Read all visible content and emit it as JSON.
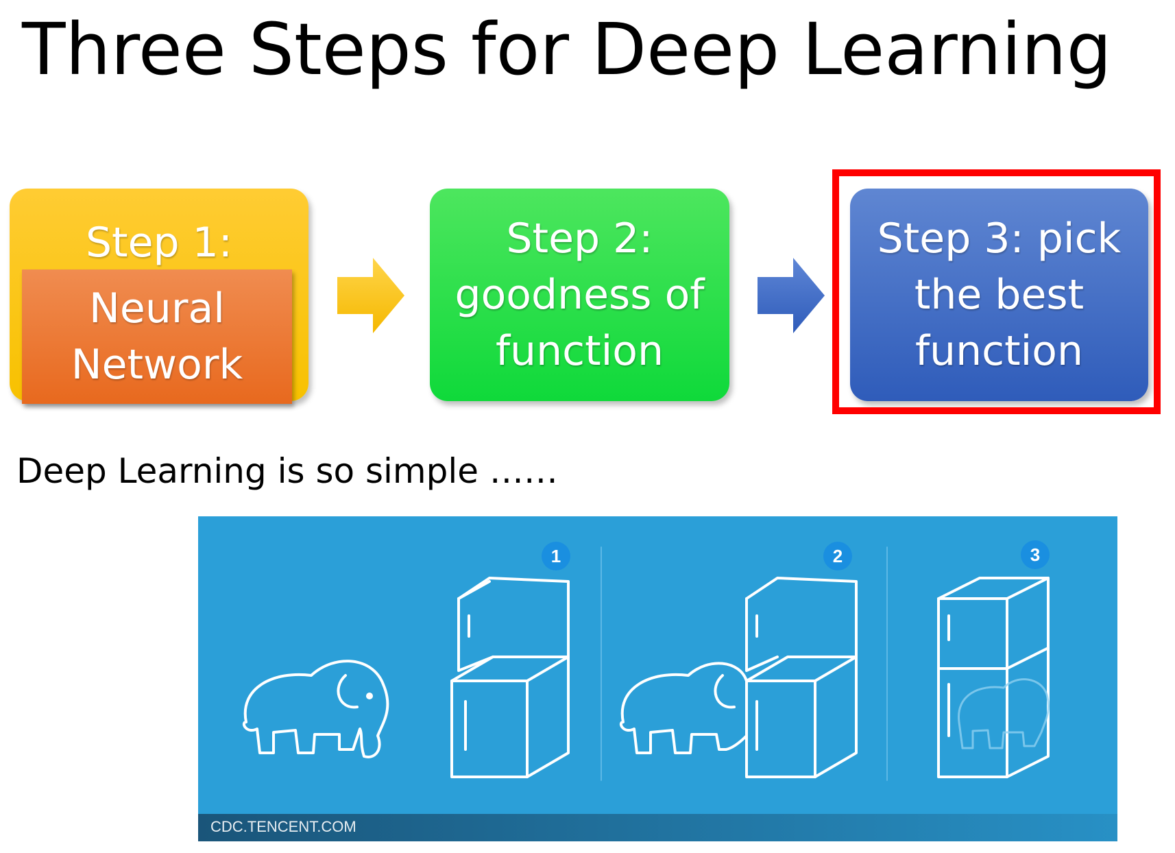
{
  "title": "Three Steps for Deep Learning",
  "steps": [
    {
      "head": "Step 1:",
      "inner_line1": "Neural",
      "inner_line2": "Network",
      "color": "#f7c100",
      "inner_color": "#e8691e"
    },
    {
      "line1": "Step 2:",
      "line2": "goodness of",
      "line3": "function",
      "color": "#0fd93a"
    },
    {
      "line1": "Step 3: pick",
      "line2": "the best",
      "line3": "function",
      "color": "#2f5cba"
    }
  ],
  "highlight_color": "#ff0000",
  "subtitle": "Deep Learning is so simple ……",
  "illustration": {
    "background": "#2b9fd8",
    "badges": [
      "1",
      "2",
      "3"
    ],
    "watermark": "CDC.TENCENT.COM"
  }
}
